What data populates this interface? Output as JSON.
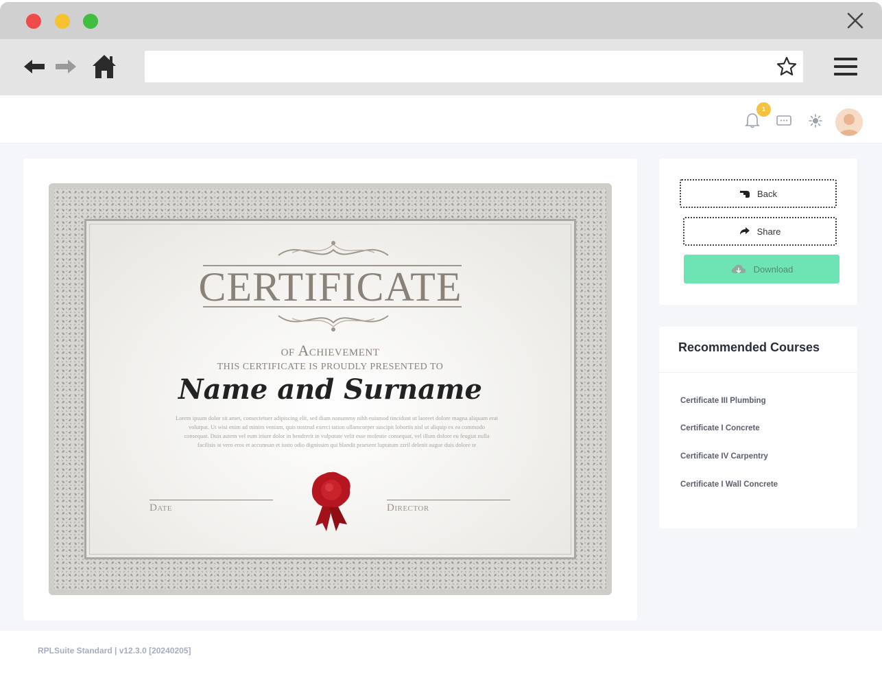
{
  "browser": {
    "traffic_lights": [
      "#ee4b4b",
      "#f5c231",
      "#3fbe3f"
    ],
    "url": ""
  },
  "header": {
    "notification_count": "1"
  },
  "certificate": {
    "title": "CERTIFICATE",
    "subtitle": "of Achievement",
    "presented_to": "THIS CERTIFICATE IS PROUDLY PRESENTED TO",
    "recipient_name": "Name and Surname",
    "body_text": "Lorem ipsum dolor sit amet, consectetuer adipiscing elit, sed diam nonummy nibh euismod tincidunt ut laoreet dolore magna aliquam erat volutpat. Ut wisi enim ad minim veniam, quis nostrud exerci tation ullamcorper suscipit lobortis nisl ut aliquip ex ea commodo consequat. Duis autem vel eum iriure dolor in hendrerit in vulputate velit esse molestie consequat, vel illum dolore eu feugiat nulla facilisis at vero eros et accumsan et iusto odio dignissim qui blandit praesent luptatum zzril delenit augue duis dolore te",
    "date_label": "Date",
    "director_label": "Director"
  },
  "actions": {
    "back_label": "Back",
    "share_label": "Share",
    "download_label": "Download"
  },
  "recommended": {
    "title": "Recommended Courses",
    "items": [
      {
        "label": "Certificate III Plumbing"
      },
      {
        "label": "Certificate I Concrete"
      },
      {
        "label": "Certificate IV Carpentry"
      },
      {
        "label": "Certificate I Wall Concrete"
      }
    ]
  },
  "footer": {
    "text": "RPLSuite Standard | v12.3.0 [20240205]"
  },
  "colors": {
    "accent_green": "#6ee3b4",
    "badge_yellow": "#f5c242"
  }
}
